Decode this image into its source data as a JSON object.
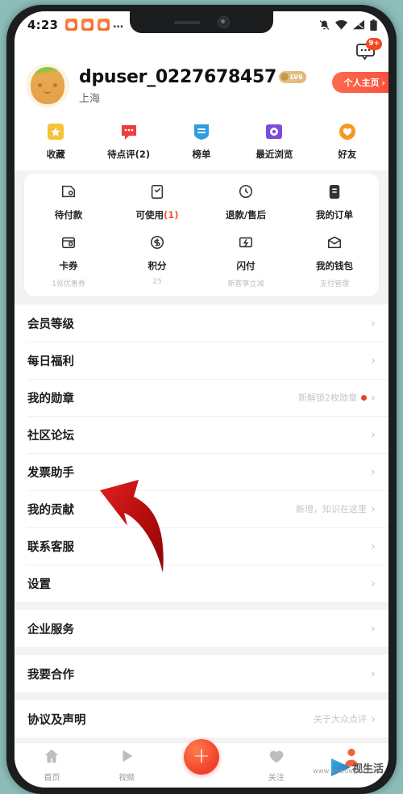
{
  "status_bar": {
    "time": "4:23",
    "notification_icons": [
      "app-notif-icon",
      "app-notif-icon",
      "app-notif-icon"
    ],
    "overflow": "…",
    "right_icons": [
      "mute-bell-icon",
      "wifi-icon",
      "signal-icon",
      "battery-icon"
    ]
  },
  "header": {
    "message_icon": "message-bubble-icon",
    "message_badge": "9+",
    "avatar": "user-avatar",
    "username": "dpuser_0227678457",
    "level_badge": "LV6",
    "city": "上海",
    "home_button": "个人主页",
    "home_button_chevron": "›"
  },
  "quick_actions": [
    {
      "label": "收藏",
      "icon": "star-bookmark-icon",
      "color": "#f5c33b"
    },
    {
      "label": "待点评(2)",
      "icon": "comment-bubble-icon",
      "color": "#ee3f3f"
    },
    {
      "label": "榜单",
      "icon": "ranking-shield-icon",
      "color": "#2e9ee0"
    },
    {
      "label": "最近浏览",
      "icon": "recent-browse-icon",
      "color": "#7b4ddb"
    },
    {
      "label": "好友",
      "icon": "friends-heart-icon",
      "color": "#f49a1e"
    }
  ],
  "order_grid": {
    "row1": [
      {
        "label": "待付款",
        "count": "",
        "sub": "",
        "icon": "wallet-pay-icon"
      },
      {
        "label": "可使用",
        "count": "(1)",
        "sub": "",
        "icon": "clipboard-check-icon"
      },
      {
        "label": "退款/售后",
        "count": "",
        "sub": "",
        "icon": "refund-icon"
      },
      {
        "label": "我的订单",
        "count": "",
        "sub": "",
        "icon": "order-list-icon"
      }
    ],
    "row2": [
      {
        "label": "卡券",
        "count": "",
        "sub": "1张优惠券",
        "icon": "coupon-card-icon"
      },
      {
        "label": "积分",
        "count": "",
        "sub": "25",
        "icon": "points-coin-icon"
      },
      {
        "label": "闪付",
        "count": "",
        "sub": "新客享立减",
        "icon": "flash-pay-icon"
      },
      {
        "label": "我的钱包",
        "count": "",
        "sub": "支付管理",
        "icon": "my-wallet-icon"
      }
    ]
  },
  "list_groups": [
    {
      "items": [
        {
          "label": "会员等级",
          "hint": "",
          "dot": false
        },
        {
          "label": "每日福利",
          "hint": "",
          "dot": false
        },
        {
          "label": "我的勋章",
          "hint": "新解锁2枚勋章",
          "dot": true
        },
        {
          "label": "社区论坛",
          "hint": "",
          "dot": false
        },
        {
          "label": "发票助手",
          "hint": "",
          "dot": false
        },
        {
          "label": "我的贡献",
          "hint": "新增，知识在这里",
          "dot": false
        },
        {
          "label": "联系客服",
          "hint": "",
          "dot": false
        },
        {
          "label": "设置",
          "hint": "",
          "dot": false
        }
      ]
    },
    {
      "items": [
        {
          "label": "企业服务",
          "hint": "",
          "dot": false
        }
      ]
    },
    {
      "items": [
        {
          "label": "我要合作",
          "hint": "",
          "dot": false
        }
      ]
    },
    {
      "items": [
        {
          "label": "协议及声明",
          "hint": "关于大众点评",
          "dot": false
        }
      ]
    }
  ],
  "bottom_nav": {
    "items": [
      {
        "label": "首页",
        "icon": "home-icon"
      },
      {
        "label": "视频",
        "icon": "video-play-icon"
      },
      {
        "label": "",
        "icon": "add-plus-fab-icon"
      },
      {
        "label": "关注",
        "icon": "heart-follow-icon"
      },
      {
        "label": "",
        "icon": "profile-avatar-icon"
      }
    ]
  },
  "annotation": {
    "arrow": "red-curved-arrow-pointing-to-invoice-assistant"
  },
  "watermark": {
    "text": "视生活",
    "url": "WWW.SHIDONGSM.COM"
  },
  "colors": {
    "background": "#8cbdb9",
    "accent_red": "#f2533a",
    "frame": "#1b1d1e"
  }
}
